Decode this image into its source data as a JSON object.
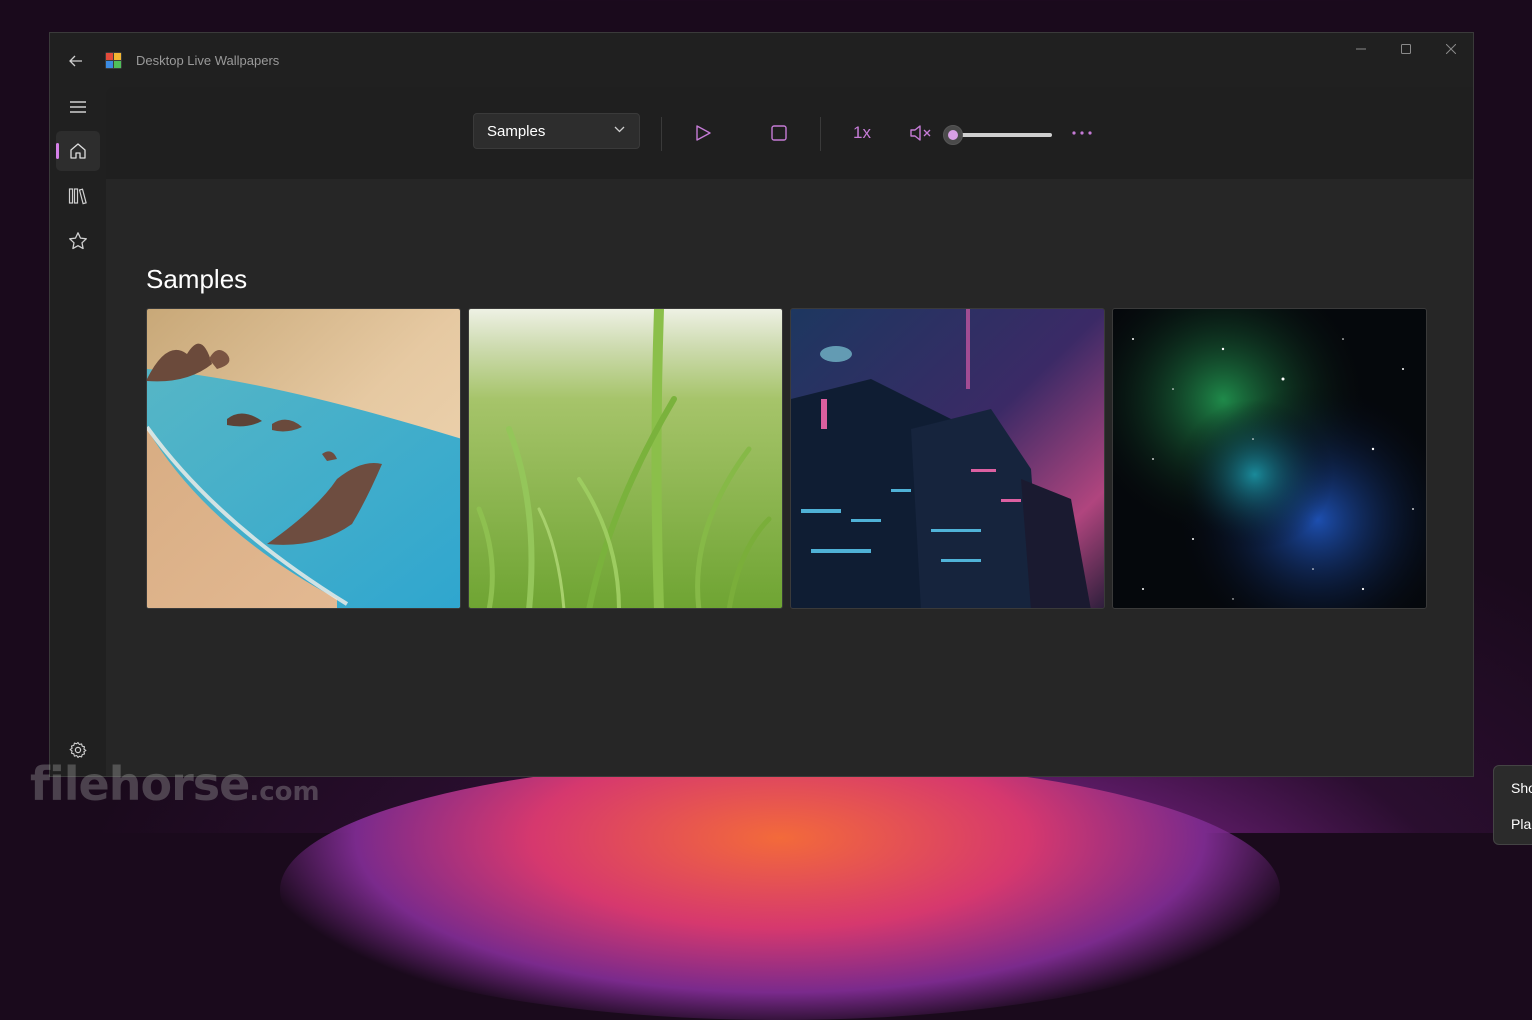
{
  "window": {
    "title": "Desktop Live Wallpapers"
  },
  "toolbar": {
    "collection": "Samples",
    "speed": "1x",
    "volume_level": 0,
    "muted": true
  },
  "main": {
    "heading": "Samples",
    "wallpapers": [
      {
        "name": "beach-coast"
      },
      {
        "name": "green-grass"
      },
      {
        "name": "cyberpunk-city"
      },
      {
        "name": "space-nebula"
      }
    ]
  },
  "watermark": {
    "text": "filehorse",
    "suffix": ".com"
  },
  "context_menu": {
    "items": [
      "Sho",
      "Pla"
    ]
  },
  "colors": {
    "accent": "#d580e8",
    "background": "#202020",
    "content": "#262626"
  }
}
